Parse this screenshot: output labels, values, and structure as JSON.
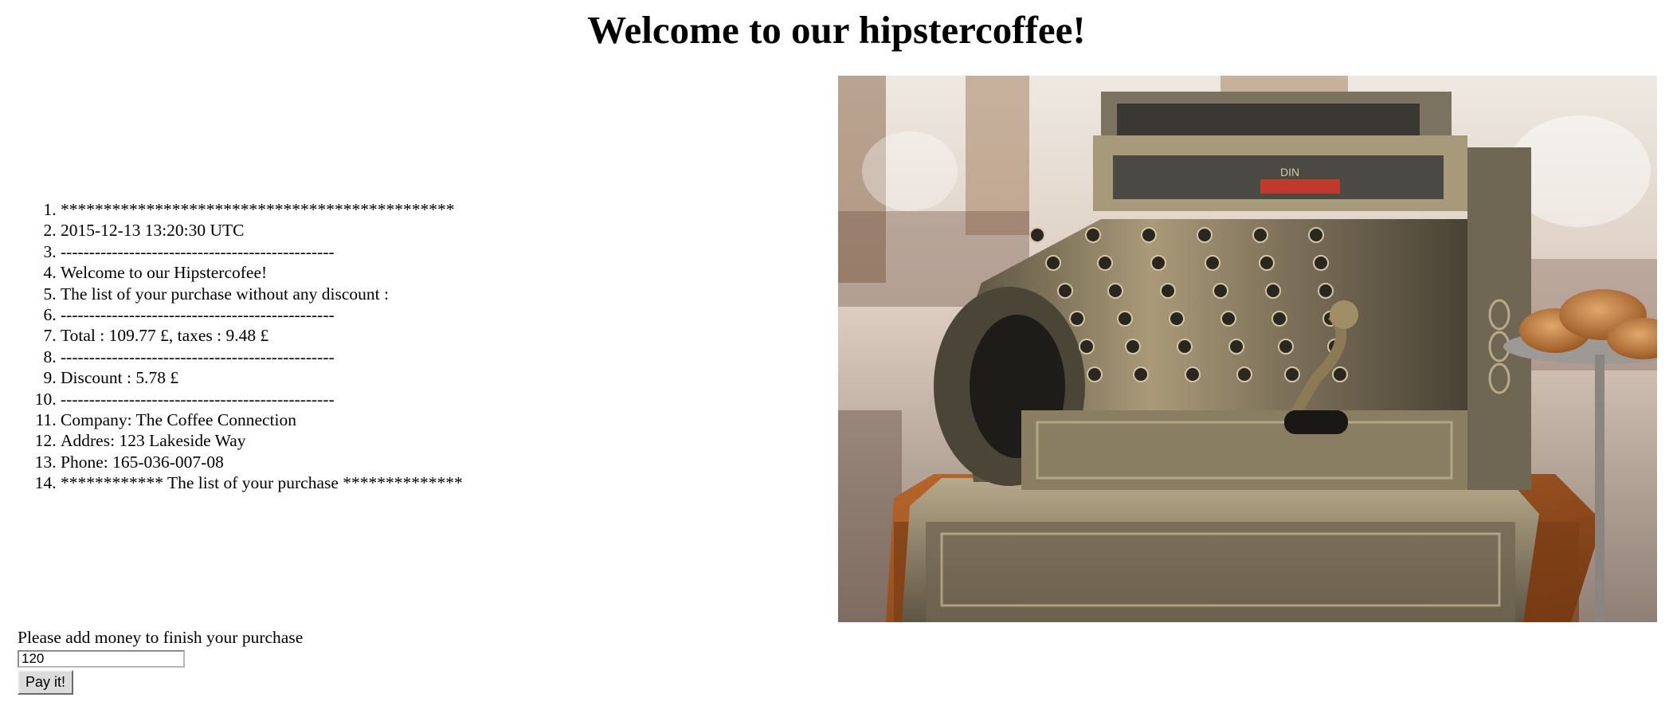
{
  "header": {
    "title": "Welcome to our hipstercoffee!"
  },
  "receipt": {
    "lines": [
      "**********************************************",
      "2015-12-13 13:20:30 UTC",
      "------------------------------------------------",
      "Welcome to our Hipstercofee!",
      "The list of your purchase without any discount :",
      "------------------------------------------------",
      "Total : 109.77 £, taxes : 9.48 £",
      "------------------------------------------------",
      "Discount : 5.78 £",
      "------------------------------------------------",
      "Company: The Coffee Connection",
      "Addres: 123 Lakeside Way",
      "Phone: 165-036-007-08",
      "************ The list of your purchase **************"
    ]
  },
  "image": {
    "icon": "cash-register-photo",
    "alt": ""
  },
  "payment": {
    "prompt": "Please add money to finish your purchase",
    "amount_value": "120",
    "pay_button_label": "Pay it!"
  }
}
